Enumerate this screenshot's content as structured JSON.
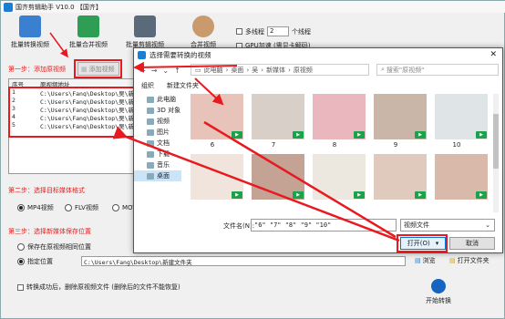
{
  "app": {
    "title": "国齐剪辑助手 V10.0 【国齐】",
    "tools": [
      {
        "label": "批量转换视频"
      },
      {
        "label": "批量合并视频"
      },
      {
        "label": "批量剪辑视频"
      },
      {
        "label": "合并视频"
      }
    ],
    "multithread_label": "多线程",
    "thread_count": "2",
    "thread_unit": "个线程",
    "gpu_label": "GPU加速 (需显卡解码)",
    "step1": "第一步：添加原视频",
    "add_button": "添加视频",
    "grid_headers": [
      "序号",
      "原视频地址"
    ],
    "grid_rows": [
      {
        "no": "1",
        "path": "C:\\Users\\Fang\\Desktop\\吴\\新媒体"
      },
      {
        "no": "2",
        "path": "C:\\Users\\Fang\\Desktop\\吴\\新媒体"
      },
      {
        "no": "3",
        "path": "C:\\Users\\Fang\\Desktop\\吴\\新媒体"
      },
      {
        "no": "4",
        "path": "C:\\Users\\Fang\\Desktop\\吴\\新媒体"
      },
      {
        "no": "5",
        "path": "C:\\Users\\Fang\\Desktop\\吴\\新媒体"
      }
    ],
    "step2": "第二步：选择目标媒体格式",
    "formats": [
      "MP4视频",
      "FLV视频",
      "MOV视频"
    ],
    "step3": "第三步：选择新媒体保存位置",
    "save_original": "保存在原视频相同位置",
    "save_custom": "指定位置",
    "save_path": "C:\\Users\\Fang\\Desktop\\新建文件夹",
    "browse": "浏览",
    "open_folder": "打开文件夹",
    "delete_label": "转换成功后，删除原视频文件 (删除后的文件不能恢复)",
    "start": "开始转换"
  },
  "dialog": {
    "title": "选择需要转换的视频",
    "breadcrumb": [
      "此电脑",
      "桌面",
      "吴",
      "新媒体",
      "原视频"
    ],
    "search_placeholder": "搜索\"原视频\"",
    "organize": "组织",
    "new_folder": "新建文件夹",
    "nav": [
      "此电脑",
      "3D 对象",
      "视频",
      "图片",
      "文档",
      "下载",
      "音乐",
      "桌面"
    ],
    "thumbs": [
      {
        "label": "6",
        "color": "#e7c3b9"
      },
      {
        "label": "7",
        "color": "#d8cfc8"
      },
      {
        "label": "8",
        "color": "#e9b7bd"
      },
      {
        "label": "9",
        "color": "#c9b6a8"
      },
      {
        "label": "10",
        "color": "#dfe5e6"
      },
      {
        "label": "",
        "color": "#f0e4dc"
      },
      {
        "label": "",
        "color": "#c4a394"
      },
      {
        "label": "",
        "color": "#ece7df"
      },
      {
        "label": "",
        "color": "#e0c9bd"
      },
      {
        "label": "",
        "color": "#d9b9aa"
      }
    ],
    "filename_label": "文件名(N):",
    "filename_value": "\"6\" \"7\" \"8\" \"9\" \"10\"",
    "filetype": "视频文件",
    "open": "打开(O)",
    "cancel": "取消"
  }
}
